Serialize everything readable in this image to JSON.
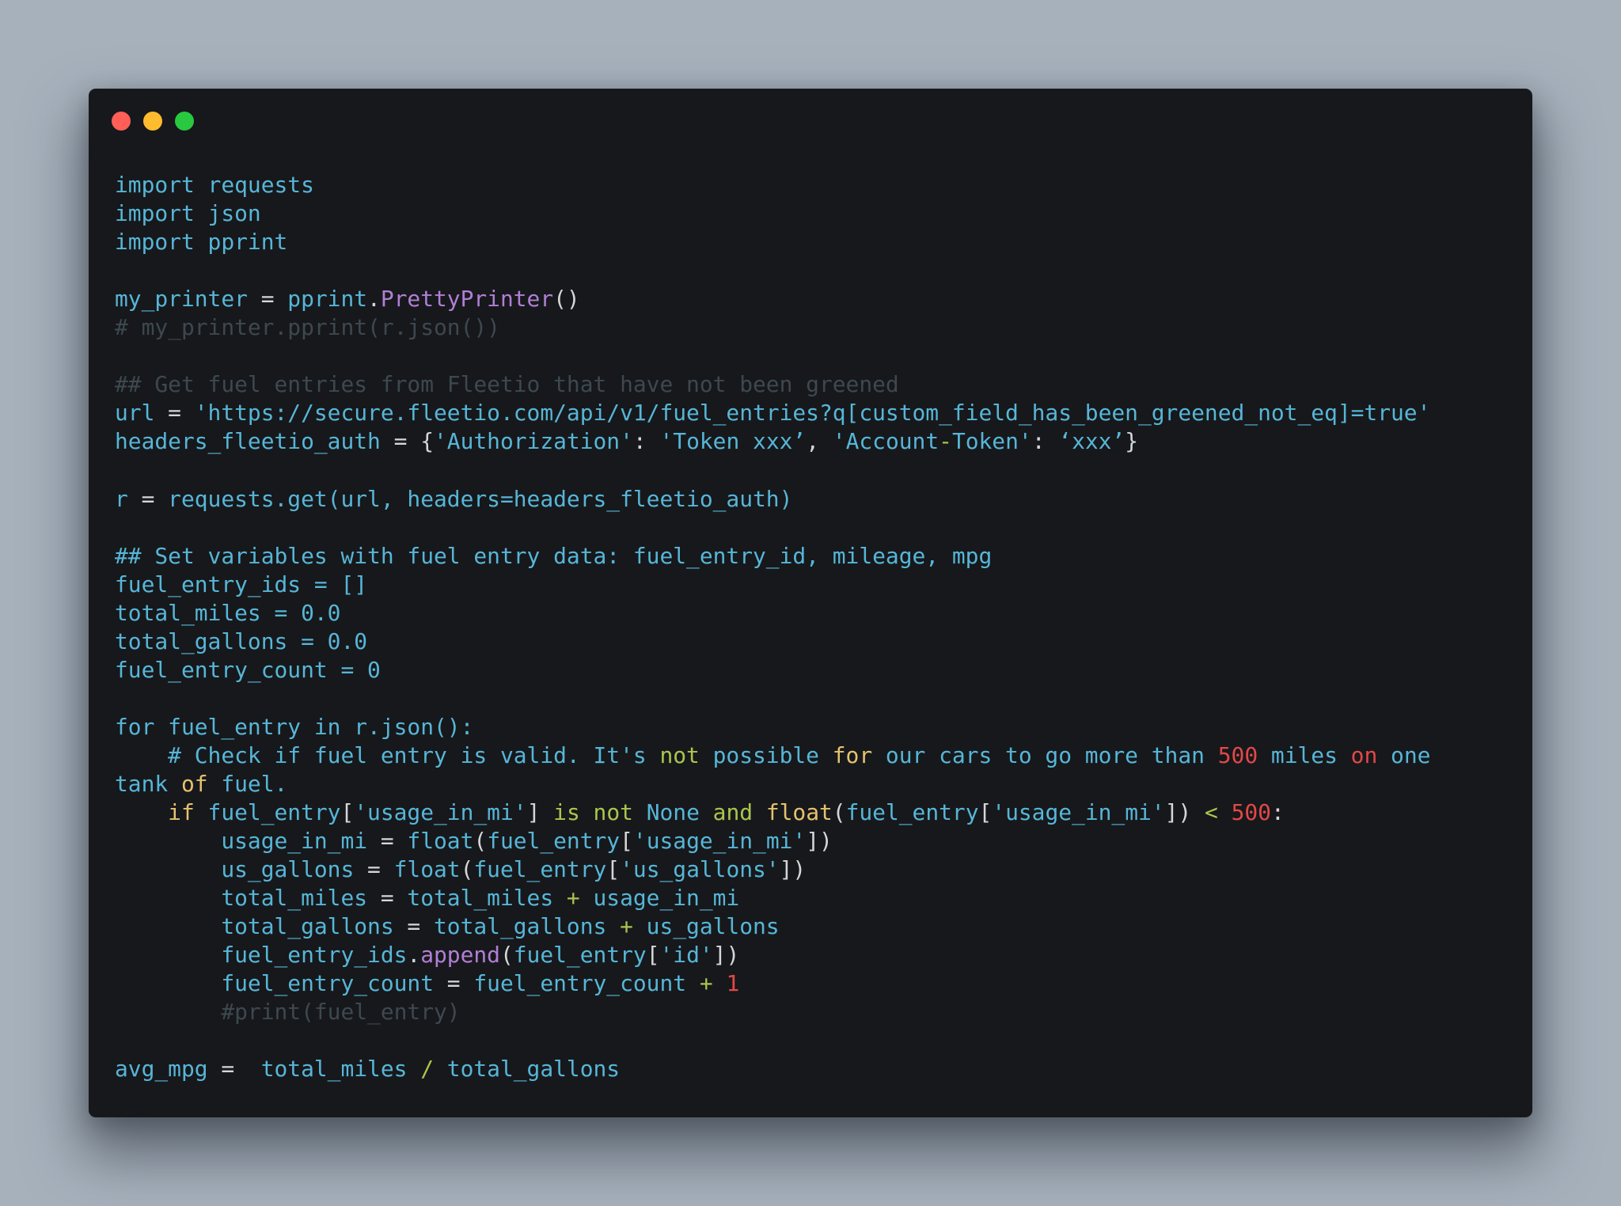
{
  "window": {
    "controls": [
      "close",
      "minimize",
      "maximize"
    ],
    "colors": {
      "close": "#ff5f57",
      "minimize": "#febc2e",
      "maximize": "#28c840",
      "background": "#17181b"
    }
  },
  "code": {
    "language": "python",
    "lines": [
      [
        [
          "id",
          "import requests"
        ]
      ],
      [
        [
          "id",
          "import json"
        ]
      ],
      [
        [
          "id",
          "import pprint"
        ]
      ],
      [],
      [
        [
          "id",
          "my_printer"
        ],
        [
          "op",
          " = "
        ],
        [
          "id",
          "pprint"
        ],
        [
          "op",
          "."
        ],
        [
          "fn",
          "PrettyPrinter"
        ],
        [
          "op",
          "()"
        ]
      ],
      [
        [
          "cm",
          "# my_printer.pprint(r.json())"
        ]
      ],
      [],
      [
        [
          "cm",
          "## Get fuel entries from Fleetio that have not been greened"
        ]
      ],
      [
        [
          "id",
          "url"
        ],
        [
          "op",
          " = "
        ],
        [
          "id",
          "'https://secure.fleetio.com/api/v1/fuel_entries?q[custom_field_has_been_greened_not_eq]=true'"
        ]
      ],
      [
        [
          "id",
          "headers_fleetio_auth"
        ],
        [
          "op",
          " = {"
        ],
        [
          "id",
          "'Authorization'"
        ],
        [
          "op",
          ": "
        ],
        [
          "id",
          "'Token xxx’"
        ],
        [
          "op",
          ", "
        ],
        [
          "id",
          "'Account"
        ],
        [
          "gr",
          "-"
        ],
        [
          "id",
          "Token'"
        ],
        [
          "op",
          ": "
        ],
        [
          "id",
          "‘xxx’"
        ],
        [
          "op",
          "}"
        ]
      ],
      [],
      [
        [
          "id",
          "r"
        ],
        [
          "op",
          " = "
        ],
        [
          "id",
          "requests.get(url, headers=headers_fleetio_auth)"
        ]
      ],
      [],
      [
        [
          "id",
          "## Set variables with fuel entry data: fuel_entry_id, mileage, mpg"
        ]
      ],
      [
        [
          "id",
          "fuel_entry_ids = []"
        ]
      ],
      [
        [
          "id",
          "total_miles = 0.0"
        ]
      ],
      [
        [
          "id",
          "total_gallons = 0.0"
        ]
      ],
      [
        [
          "id",
          "fuel_entry_count = 0"
        ]
      ],
      [],
      [
        [
          "id",
          "for fuel_entry in r.json():"
        ]
      ],
      [
        [
          "id",
          "    # Check if fuel entry is valid. It's "
        ],
        [
          "gr",
          "not"
        ],
        [
          "id",
          " possible "
        ],
        [
          "kw",
          "for"
        ],
        [
          "id",
          " our cars to go more than "
        ],
        [
          "num",
          "500"
        ],
        [
          "id",
          " miles "
        ],
        [
          "num",
          "on"
        ],
        [
          "id",
          " one"
        ]
      ],
      [
        [
          "id",
          "tank "
        ],
        [
          "kw",
          "of"
        ],
        [
          "id",
          " fuel."
        ]
      ],
      [
        [
          "kw",
          "    if"
        ],
        [
          "id",
          " fuel_entry"
        ],
        [
          "op",
          "["
        ],
        [
          "id",
          "'usage_in_mi'"
        ],
        [
          "op",
          "] "
        ],
        [
          "gr",
          "is not"
        ],
        [
          "id",
          " None "
        ],
        [
          "gr",
          "and"
        ],
        [
          "kw",
          " float"
        ],
        [
          "op",
          "("
        ],
        [
          "id",
          "fuel_entry"
        ],
        [
          "op",
          "["
        ],
        [
          "id",
          "'usage_in_mi'"
        ],
        [
          "op",
          "]) "
        ],
        [
          "gr",
          "<"
        ],
        [
          "op",
          " "
        ],
        [
          "num",
          "500"
        ],
        [
          "op",
          ":"
        ]
      ],
      [
        [
          "id",
          "        usage_in_mi"
        ],
        [
          "op",
          " = "
        ],
        [
          "id",
          "float"
        ],
        [
          "op",
          "("
        ],
        [
          "id",
          "fuel_entry"
        ],
        [
          "op",
          "["
        ],
        [
          "id",
          "'usage_in_mi'"
        ],
        [
          "op",
          "])"
        ]
      ],
      [
        [
          "id",
          "        us_gallons"
        ],
        [
          "op",
          " = "
        ],
        [
          "id",
          "float"
        ],
        [
          "op",
          "("
        ],
        [
          "id",
          "fuel_entry"
        ],
        [
          "op",
          "["
        ],
        [
          "id",
          "'us_gallons'"
        ],
        [
          "op",
          "])"
        ]
      ],
      [
        [
          "id",
          "        total_miles"
        ],
        [
          "op",
          " = "
        ],
        [
          "id",
          "total_miles "
        ],
        [
          "gr",
          "+"
        ],
        [
          "id",
          " usage_in_mi"
        ]
      ],
      [
        [
          "id",
          "        total_gallons"
        ],
        [
          "op",
          " = "
        ],
        [
          "id",
          "total_gallons "
        ],
        [
          "gr",
          "+"
        ],
        [
          "id",
          " us_gallons"
        ]
      ],
      [
        [
          "id",
          "        fuel_entry_ids"
        ],
        [
          "op",
          "."
        ],
        [
          "fn",
          "append"
        ],
        [
          "op",
          "("
        ],
        [
          "id",
          "fuel_entry"
        ],
        [
          "op",
          "["
        ],
        [
          "id",
          "'id'"
        ],
        [
          "op",
          "])"
        ]
      ],
      [
        [
          "id",
          "        fuel_entry_count"
        ],
        [
          "op",
          " = "
        ],
        [
          "id",
          "fuel_entry_count "
        ],
        [
          "gr",
          "+"
        ],
        [
          "op",
          " "
        ],
        [
          "num",
          "1"
        ]
      ],
      [
        [
          "cm",
          "        #print(fuel_entry)"
        ]
      ],
      [],
      [
        [
          "id",
          "avg_mpg"
        ],
        [
          "op",
          " =  "
        ],
        [
          "id",
          "total_miles "
        ],
        [
          "gr",
          "/"
        ],
        [
          "id",
          " total_gallons"
        ]
      ]
    ]
  }
}
